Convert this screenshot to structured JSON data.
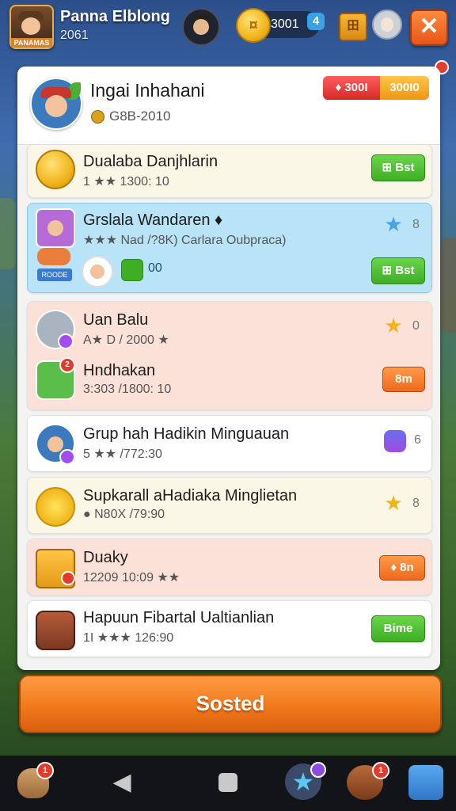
{
  "topbar": {
    "player_name": "Panna Elblong",
    "player_sub": "2061",
    "player_tag": "PANAMAS",
    "coins": "3001",
    "coin_plus": "4",
    "box_label": "田",
    "close_label": "✕"
  },
  "header": {
    "title": "Ingai Inhahani",
    "subtitle": "G8B-2010",
    "btn_red": "♦ 300I",
    "btn_orange": "300I0"
  },
  "list": [
    {
      "title": "Dualaba Danjhlarin",
      "sub": "1 ★★ 1300: 10",
      "button": "⊞ Bst"
    },
    {
      "title": "Grslala Wandaren ♦",
      "sub": "★★★ Nad /?8K) Carlara Oubpraca)",
      "count": "8",
      "friend_count": "00",
      "tag": "ROODE",
      "button": "⊞ Bst"
    },
    {
      "title": "Uan Balu",
      "sub": "A★ D / 2000 ★",
      "count": "0"
    },
    {
      "title": "Hndhakan",
      "sub": "3:303 /1800: 10",
      "button": "8m",
      "badge": "2"
    },
    {
      "title": "Grup hah Hadikin Minguauan",
      "sub": "5 ★★ /772:30",
      "count": "6"
    },
    {
      "title": "Supkarall aHadiaka Minglietan",
      "sub": "● N80X /79:90",
      "count": "8"
    },
    {
      "title": "Duaky",
      "sub": "12209 10:09 ★★",
      "button": "♦ 8n"
    },
    {
      "title": "Hapuun Fibartal Ualtianlian",
      "sub": "1I ★★★ 126:90",
      "button": "Bime"
    }
  ],
  "footer": {
    "start_label": "Sosted"
  },
  "navbar": {
    "badge_1": "1",
    "badge_2": "1"
  },
  "colors": {
    "green_button": "#4fc02f",
    "orange_button": "#f07a1c",
    "blue_row": "#b9e3f7",
    "pink_row": "#fbe1d8",
    "cream_row": "#fbf7e6"
  }
}
